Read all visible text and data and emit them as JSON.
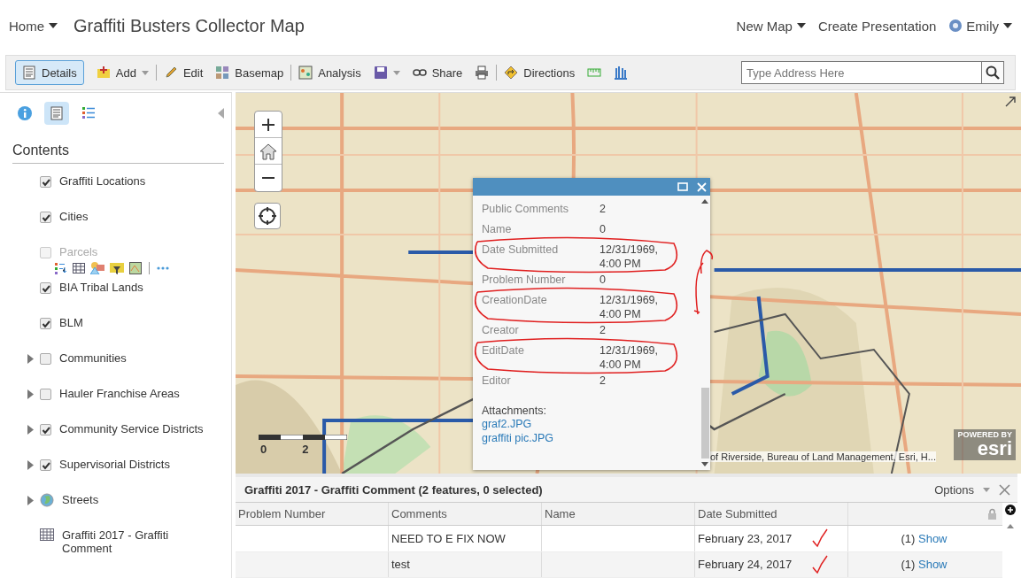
{
  "header": {
    "home": "Home",
    "title": "Graffiti Busters Collector Map",
    "new_map": "New Map",
    "create_presentation": "Create Presentation",
    "user": "Emily"
  },
  "toolbar": {
    "items": [
      {
        "kind": "details",
        "label": "Details",
        "selected": true
      },
      {
        "kind": "add",
        "label": "Add",
        "selected": false,
        "caret": true
      },
      {
        "kind": "edit",
        "label": "Edit",
        "selected": false
      },
      {
        "kind": "basemap",
        "label": "Basemap",
        "selected": false
      },
      {
        "kind": "analysis",
        "label": "Analysis",
        "selected": false
      },
      {
        "kind": "save",
        "selected": false,
        "caret": true
      },
      {
        "kind": "share",
        "label": "Share",
        "selected": false
      },
      {
        "kind": "print",
        "selected": false
      },
      {
        "kind": "directions",
        "label": "Directions",
        "selected": false
      },
      {
        "kind": "measure",
        "selected": false
      },
      {
        "kind": "bookmarks",
        "selected": false
      }
    ],
    "search": {
      "placeholder": "Type Address Here"
    }
  },
  "sidebar": {
    "tabs": [
      {
        "kind": "about",
        "selected": false
      },
      {
        "kind": "content",
        "selected": true
      },
      {
        "kind": "legend",
        "selected": false
      }
    ],
    "heading": "Contents",
    "layers": [
      {
        "kind": "layer",
        "name": "Graffiti Locations",
        "checked": true
      },
      {
        "kind": "layer",
        "name": "Cities",
        "checked": true
      },
      {
        "kind": "layer",
        "name": "Parcels",
        "checked": false,
        "disabled": true,
        "tools": true
      },
      {
        "kind": "layer",
        "name": "BIA Tribal Lands",
        "checked": true
      },
      {
        "kind": "layer",
        "name": "BLM",
        "checked": true
      },
      {
        "kind": "layer",
        "name": "Communities",
        "checked": false,
        "expandable": true
      },
      {
        "kind": "layer",
        "name": "Hauler Franchise Areas",
        "checked": false,
        "expandable": true
      },
      {
        "kind": "layer",
        "name": "Community Service Districts",
        "checked": true,
        "expandable": true
      },
      {
        "kind": "layer",
        "name": "Supervisorial Districts",
        "checked": true,
        "expandable": true
      },
      {
        "kind": "basemap",
        "name": "Streets",
        "expandable": true
      },
      {
        "kind": "table",
        "name": "Graffiti 2017 - Graffiti Comment"
      }
    ]
  },
  "map": {
    "scale_labels": [
      "0",
      "2"
    ],
    "attribution": "of Riverside, Bureau of Land Management, Esri, H...",
    "logo_caption": "POWERED BY",
    "logo": "esri"
  },
  "popup": {
    "fields": [
      {
        "label": "Public Comments",
        "value": "2"
      },
      {
        "label": "Name",
        "value": "0"
      },
      {
        "label": "Date Submitted",
        "value": "12/31/1969, 4:00 PM",
        "circled": true
      },
      {
        "label": "Problem Number",
        "value": "0"
      },
      {
        "label": "CreationDate",
        "value": "12/31/1969, 4:00 PM",
        "circled": true
      },
      {
        "label": "Creator",
        "value": "2"
      },
      {
        "label": "EditDate",
        "value": "12/31/1969, 4:00 PM",
        "circled": true
      },
      {
        "label": "Editor",
        "value": "2"
      }
    ],
    "attachments_label": "Attachments:",
    "attachments": [
      "graf2.JPG",
      "graffiti pic.JPG"
    ]
  },
  "table": {
    "title": "Graffiti 2017 - Graffiti Comment (2 features, 0 selected)",
    "options": "Options",
    "columns": [
      "Problem Number",
      "Comments",
      "Name",
      "Date Submitted"
    ],
    "rows": [
      {
        "cells": [
          "",
          "NEED TO E FIX NOW",
          "",
          "February 23, 2017"
        ],
        "count": "(1)",
        "link": "Show",
        "ticked": true
      },
      {
        "cells": [
          "",
          "test",
          "",
          "February 24, 2017"
        ],
        "count": "(1)",
        "link": "Show",
        "ticked": true
      }
    ]
  }
}
